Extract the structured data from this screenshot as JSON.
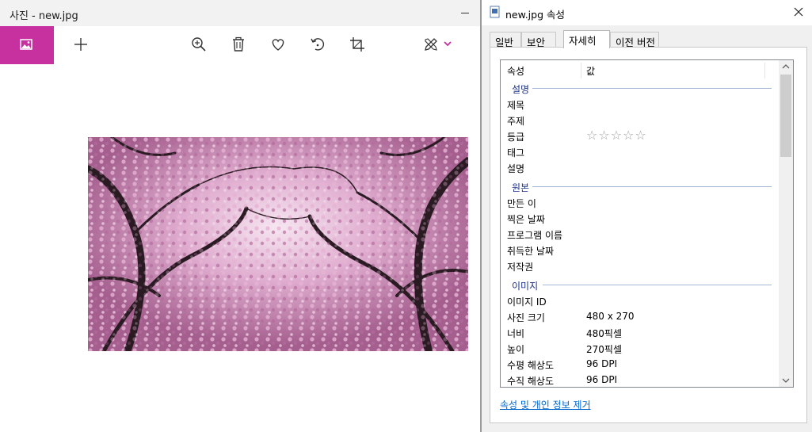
{
  "photos_app": {
    "title": "사진 - new.jpg",
    "toolbar_icons": [
      "photos-icon",
      "add-icon",
      "zoom-in-icon",
      "delete-icon",
      "heart-icon",
      "rotate-icon",
      "crop-icon",
      "edit-draw-icon",
      "chevron-down-icon"
    ],
    "accent_color": "#c6309f"
  },
  "properties": {
    "title": "new.jpg 속성",
    "tabs": [
      "일반",
      "보안",
      "자세히",
      "이전 버전"
    ],
    "active_tab": "자세히",
    "list_header": {
      "property": "속성",
      "value": "값"
    },
    "groups": [
      {
        "name": "설명",
        "items": [
          {
            "key": "제목",
            "value": ""
          },
          {
            "key": "주제",
            "value": ""
          },
          {
            "key": "등급",
            "value": "☆☆☆☆☆"
          },
          {
            "key": "태그",
            "value": ""
          },
          {
            "key": "설명",
            "value": ""
          }
        ]
      },
      {
        "name": "원본",
        "items": [
          {
            "key": "만든 이",
            "value": ""
          },
          {
            "key": "찍은 날짜",
            "value": ""
          },
          {
            "key": "프로그램 이름",
            "value": ""
          },
          {
            "key": "취득한 날짜",
            "value": ""
          },
          {
            "key": "저작권",
            "value": ""
          }
        ]
      },
      {
        "name": "이미지",
        "items": [
          {
            "key": "이미지 ID",
            "value": ""
          },
          {
            "key": "사진 크기",
            "value": "480 x 270"
          },
          {
            "key": "너비",
            "value": "480픽셀"
          },
          {
            "key": "높이",
            "value": "270픽셀"
          },
          {
            "key": "수평 해상도",
            "value": "96 DPI"
          },
          {
            "key": "수직 해상도",
            "value": "96 DPI"
          }
        ]
      }
    ],
    "rating_stars": 0,
    "remove_link": "속성 및 개인 정보 제거"
  }
}
